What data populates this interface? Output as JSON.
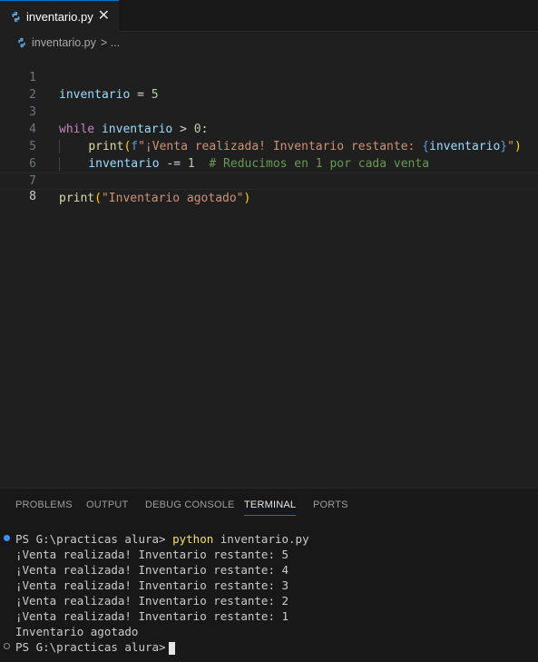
{
  "tab": {
    "filename": "inventario.py",
    "close": "✕"
  },
  "breadcrumb": {
    "file": "inventario.py",
    "rest": "> ..."
  },
  "editor": {
    "line_numbers": [
      "1",
      "2",
      "3",
      "4",
      "5",
      "6",
      "7",
      "8"
    ],
    "active_line": "8"
  },
  "panel": {
    "tabs": [
      "PROBLEMS",
      "OUTPUT",
      "DEBUG CONSOLE",
      "TERMINAL",
      "PORTS"
    ],
    "active_tab": "TERMINAL"
  },
  "terminal": {
    "prompt": "PS G:\\practicas alura> ",
    "command": "python",
    "command_arg": " inventario.py",
    "output": [
      "¡Venta realizada! Inventario restante: 5",
      "¡Venta realizada! Inventario restante: 4",
      "¡Venta realizada! Inventario restante: 3",
      "¡Venta realizada! Inventario restante: 2",
      "¡Venta realizada! Inventario restante: 1",
      "Inventario agotado"
    ],
    "final_prompt": "PS G:\\practicas alura>"
  },
  "colors": {
    "accent": "#0078d4",
    "status_ok": "#3794ff"
  }
}
